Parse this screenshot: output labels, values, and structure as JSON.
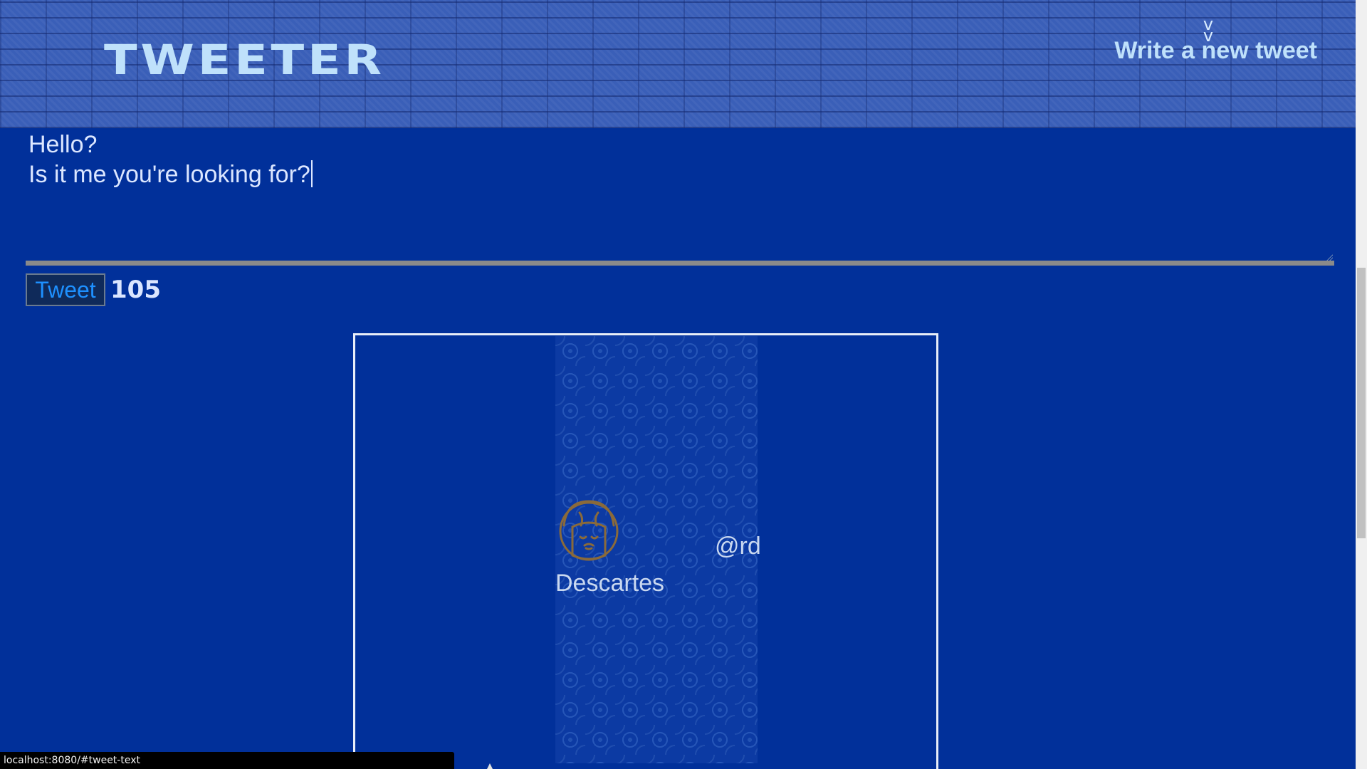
{
  "header": {
    "logo_text": "TWEETER",
    "compose_toggle_label": "Write a new tweet",
    "toggle_icon": "double-chevron-down-icon",
    "toggle_glyph": "v\nv"
  },
  "composer": {
    "tweet_text": "Hello?\nIs it me you're looking for?",
    "submit_label": "Tweet",
    "char_counter": "105"
  },
  "tweet": {
    "avatar_icon": "user-avatar-icon",
    "handle": "@rd",
    "display_name": "Descartes"
  },
  "status_bar": {
    "url": "localhost:8080/#tweet-text"
  },
  "colors": {
    "background": "#01309a",
    "header_text": "#bfe1fb",
    "button_text": "#1e90ff",
    "avatar_stroke": "#8a6a3a"
  }
}
